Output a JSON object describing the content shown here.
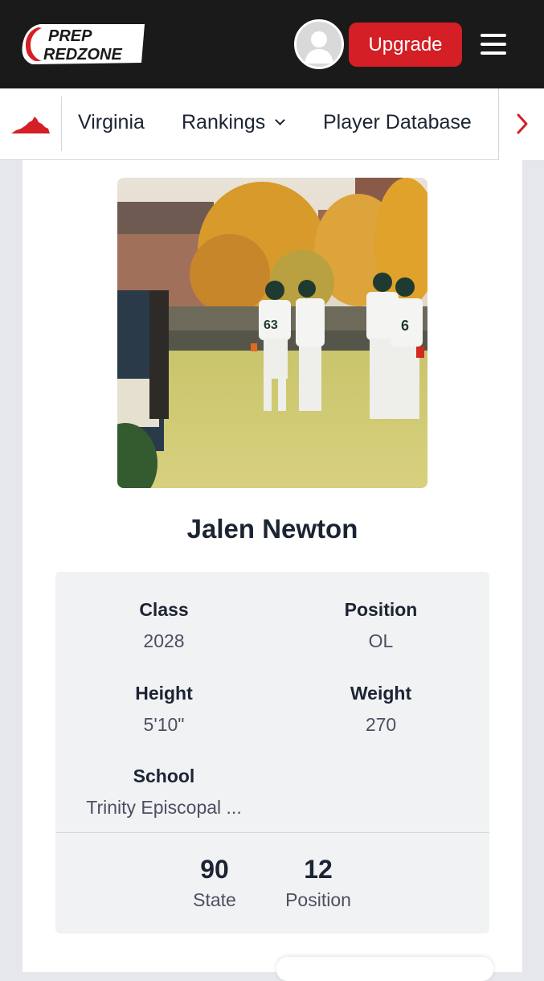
{
  "header": {
    "logo_text": "PREP REDZONE",
    "logo_line1": "PREP",
    "logo_line2": "REDZONE",
    "upgrade_label": "Upgrade",
    "brand_color": "#d41f26"
  },
  "nav": {
    "state_icon": "virginia-state-icon",
    "items": [
      {
        "label": "Virginia"
      },
      {
        "label": "Rankings",
        "has_dropdown": true
      },
      {
        "label": "Player Database"
      }
    ]
  },
  "player": {
    "name": "Jalen Newton",
    "stats": [
      {
        "label": "Class",
        "value": "2028"
      },
      {
        "label": "Position",
        "value": "OL"
      },
      {
        "label": "Height",
        "value": "5'10\""
      },
      {
        "label": "Weight",
        "value": "270"
      },
      {
        "label": "School",
        "value": "Trinity Episcopal ..."
      }
    ],
    "rankings": [
      {
        "number": "90",
        "label": "State"
      },
      {
        "number": "12",
        "label": "Position"
      }
    ]
  }
}
